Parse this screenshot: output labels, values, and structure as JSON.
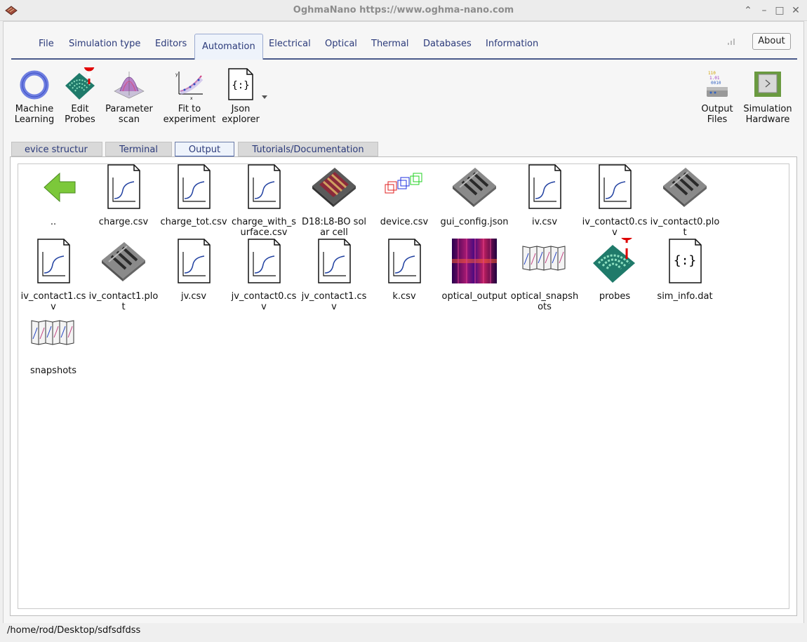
{
  "window": {
    "title": "OghmaNano https://www.oghma-nano.com",
    "controls": [
      "chevron-up-icon",
      "minimize-icon",
      "maximize-icon",
      "close-icon"
    ]
  },
  "menu": {
    "tabs": [
      "File",
      "Simulation type",
      "Editors",
      "Automation",
      "Electrical",
      "Optical",
      "Thermal",
      "Databases",
      "Information"
    ],
    "active": "Automation",
    "about_label": "About"
  },
  "toolbar": {
    "tools": [
      {
        "line1": "Machine",
        "line2": "Learning",
        "icon": "ring-icon"
      },
      {
        "line1": "Edit",
        "line2": "Probes",
        "icon": "probe-map-icon"
      },
      {
        "line1": "Parameter",
        "line2": "scan",
        "icon": "surface-plot-icon"
      },
      {
        "line1": "Fit to",
        "line2": "experiment",
        "icon": "fit-plot-icon"
      },
      {
        "line1": "Json",
        "line2": "explorer",
        "icon": "json-file-icon"
      },
      {
        "line1": "Output",
        "line2": "Files",
        "icon": "output-files-icon"
      },
      {
        "line1": "Simulation",
        "line2": "Hardware",
        "icon": "hardware-chip-icon"
      }
    ]
  },
  "subtabs": {
    "tabs": [
      "evice structur",
      "Terminal",
      "Output",
      "Tutorials/Documentation"
    ],
    "active": "Output"
  },
  "files": [
    {
      "name": "..",
      "icon": "back-arrow-icon"
    },
    {
      "name": "charge.csv",
      "icon": "csv-plot-icon"
    },
    {
      "name": "charge_tot.csv",
      "icon": "csv-plot-icon"
    },
    {
      "name": "charge_with_surface.csv",
      "icon": "csv-plot-icon"
    },
    {
      "name": "D18:L8-BO solar cell",
      "icon": "solar-cell-icon"
    },
    {
      "name": "device.csv",
      "icon": "cubes-icon"
    },
    {
      "name": "gui_config.json",
      "icon": "device-grey-icon"
    },
    {
      "name": "iv.csv",
      "icon": "csv-plot-icon"
    },
    {
      "name": "iv_contact0.csv",
      "icon": "csv-plot-icon"
    },
    {
      "name": "iv_contact0.plot",
      "icon": "device-grey-icon"
    },
    {
      "name": "iv_contact1.csv",
      "icon": "csv-plot-icon"
    },
    {
      "name": "iv_contact1.plot",
      "icon": "device-grey-icon"
    },
    {
      "name": "jv.csv",
      "icon": "csv-plot-icon"
    },
    {
      "name": "jv_contact0.csv",
      "icon": "csv-plot-icon"
    },
    {
      "name": "jv_contact1.csv",
      "icon": "csv-plot-icon"
    },
    {
      "name": "k.csv",
      "icon": "csv-plot-icon"
    },
    {
      "name": "optical_output",
      "icon": "optical-image-icon"
    },
    {
      "name": "optical_snapshots",
      "icon": "snapshots-icon"
    },
    {
      "name": "probes",
      "icon": "probe-map-icon"
    },
    {
      "name": "sim_info.dat",
      "icon": "json-file-icon"
    },
    {
      "name": "snapshots",
      "icon": "snapshots-icon"
    }
  ],
  "status": {
    "path": "/home/rod/Desktop/sdfsdfdss"
  }
}
